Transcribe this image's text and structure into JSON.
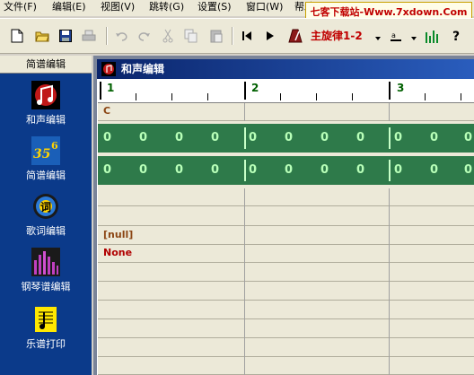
{
  "menu": {
    "file": "文件(F)",
    "edit": "编辑(E)",
    "view": "视图(V)",
    "jump": "跳转(G)",
    "settings": "设置(S)",
    "window": "窗口(W)",
    "help": "帮助(H)"
  },
  "watermark": "七客下载站-Www.7xdown.Com",
  "toolbar": {
    "melody_label": "主旋律1-2",
    "icons": [
      "new-file",
      "open-folder",
      "save",
      "print",
      "undo",
      "redo",
      "cut",
      "copy",
      "paste",
      "go-start",
      "play",
      "metronome",
      "note-style",
      "meter"
    ]
  },
  "sidebar": {
    "title": "简谱编辑",
    "items": [
      {
        "label": "和声编辑",
        "icon": "harmony-icon"
      },
      {
        "label": "简谱编辑",
        "icon": "notation-icon"
      },
      {
        "label": "歌词编辑",
        "icon": "lyrics-icon"
      },
      {
        "label": "钢琴谱编辑",
        "icon": "piano-score-icon"
      },
      {
        "label": "乐谱打印",
        "icon": "print-score-icon"
      }
    ]
  },
  "window": {
    "title": "和声编辑"
  },
  "score": {
    "measures": [
      "1",
      "2",
      "3"
    ],
    "chord": "C",
    "track1": [
      "0",
      "0",
      "0",
      "0",
      "0",
      "0",
      "0",
      "0",
      "0",
      "0",
      "0"
    ],
    "track2": [
      "0",
      "0",
      "0",
      "0",
      "0",
      "0",
      "0",
      "0",
      "0",
      "0",
      "0"
    ],
    "null_label": "[null]",
    "none_label": "None"
  },
  "colors": {
    "sidebar": "#0b3a8a",
    "title_bar": "#0a246a",
    "track_green": "#2e7a4a",
    "accent_red": "#c00000"
  }
}
